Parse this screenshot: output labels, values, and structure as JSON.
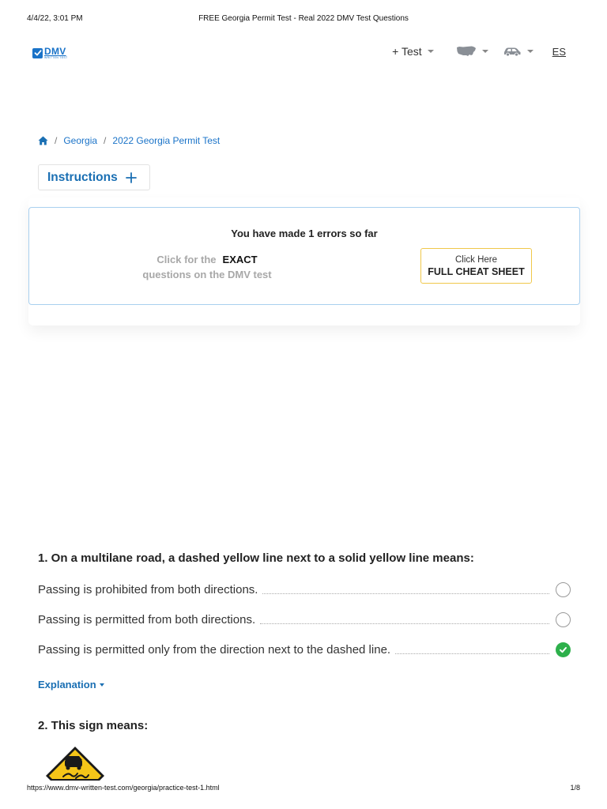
{
  "print_header": {
    "date": "4/4/22, 3:01 PM",
    "title": "FREE Georgia Permit Test - Real 2022 DMV Test Questions"
  },
  "print_footer": {
    "url": "https://www.dmv-written-test.com/georgia/practice-test-1.html",
    "page": "1/8"
  },
  "logo": {
    "main": "DMV",
    "sub": "WRITTEN TEST"
  },
  "nav": {
    "test_label": "+ Test",
    "map_icon": "usa-map-icon",
    "car_icon": "car-icon",
    "lang_label": "ES"
  },
  "breadcrumb": {
    "home_icon": "home-icon",
    "items": [
      "Georgia",
      "2022 Georgia Permit Test"
    ],
    "separator": "/"
  },
  "instructions": {
    "label": "Instructions",
    "icon": "plus-icon"
  },
  "error_panel": {
    "title": "You have made 1 errors so far",
    "promo_line1": "Click for the",
    "promo_emphasis": "EXACT",
    "promo_line2": "questions on the DMV test",
    "button_top": "Click Here",
    "button_main": "FULL CHEAT SHEET"
  },
  "questions": [
    {
      "title": "1. On a multilane road, a dashed yellow line next to a solid yellow line means:",
      "answers": [
        {
          "text": "Passing is prohibited from both directions.",
          "state": "unselected"
        },
        {
          "text": "Passing is permitted from both directions.",
          "state": "unselected"
        },
        {
          "text": "Passing is permitted only from the direction next to the dashed line.",
          "state": "correct"
        }
      ],
      "explanation_label": "Explanation"
    },
    {
      "title": "2. This sign means:",
      "image_icon": "slippery-when-wet-sign-icon"
    }
  ],
  "colors": {
    "brand_blue": "#1a73c8",
    "link_blue": "#1a6fb3",
    "correct_green": "#2db04b",
    "cheat_border": "#f0c84a",
    "panel_border": "#a9d0ef",
    "sign_yellow": "#f5c518"
  }
}
